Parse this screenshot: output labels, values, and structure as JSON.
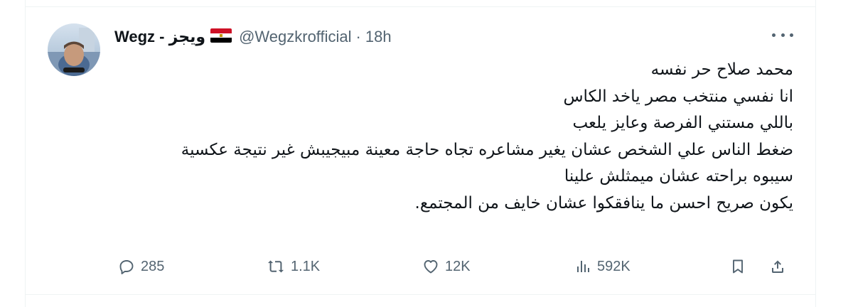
{
  "tweet": {
    "display_name": "Wegz - ويجز",
    "handle": "@Wegzkrofficial",
    "separator": "·",
    "time": "18h",
    "lines": [
      "محمد صلاح حر نفسه",
      "انا نفسي منتخب مصر ياخد الكاس",
      "باللي مستني الفرصة وعايز يلعب",
      "ضغط الناس علي الشخص عشان يغير مشاعره تجاه حاجة معينة مبيجيبش غير نتيجة عكسية",
      "سيبوه براحته عشان ميمثلش علينا",
      "يكون صريح احسن ما ينافقكوا عشان خايف من المجتمع."
    ],
    "metrics": {
      "replies": "285",
      "reposts": "1.1K",
      "likes": "12K",
      "views": "592K"
    }
  },
  "icons": {
    "more": "more-dots-icon",
    "reply": "reply-bubble-icon",
    "repost": "repost-arrows-icon",
    "like": "heart-icon",
    "views": "views-chart-icon",
    "bookmark": "bookmark-icon",
    "share": "share-upload-icon",
    "flag": "egypt-flag-icon"
  },
  "colors": {
    "text": "#0f1419",
    "muted": "#536471",
    "border": "#eff3f4",
    "flag_red": "#ce1126",
    "flag_black": "#000000",
    "flag_gold": "#c09300"
  }
}
